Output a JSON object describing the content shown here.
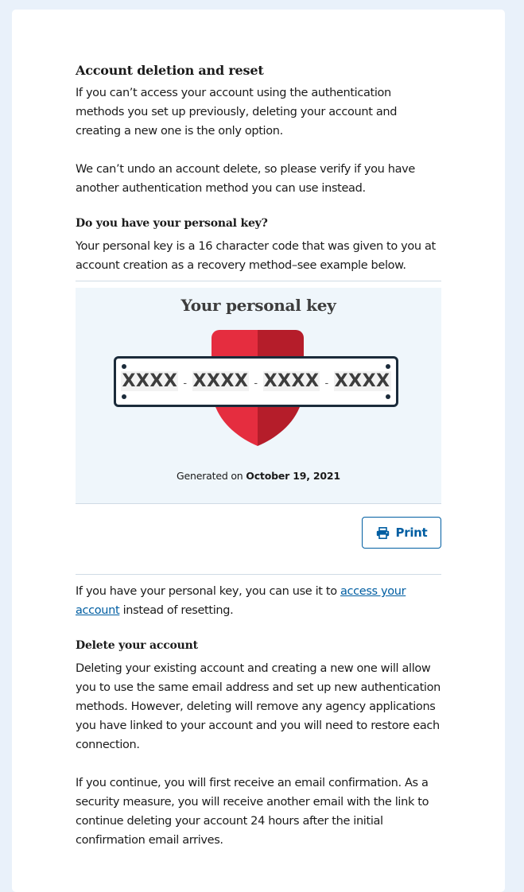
{
  "section": {
    "title": "Account deletion and reset",
    "intro": "If you can’t access your account using the authentication methods you set up previously, deleting your account and creating a new one is the only option.",
    "warning": "We can’t undo an account delete, so please verify if you have another authentication method you can use instead."
  },
  "personal_key": {
    "heading": "Do you have your personal key?",
    "description": "Your personal key is a 16 character code that was given to you at account creation as a recovery method–see example below.",
    "example_title": "Your personal key",
    "segments": [
      "XXXX",
      "XXXX",
      "XXXX",
      "XXXX"
    ],
    "separator": "-",
    "generated_prefix": "Generated on",
    "generated_date": "October 19, 2021",
    "print_label": "Print",
    "print_icon": "printer-icon",
    "access_prefix": "If you have your personal key, you can use it to",
    "access_link": "access your account",
    "access_suffix": "instead of resetting."
  },
  "delete": {
    "heading": "Delete your account",
    "paragraph1": "Deleting your existing account and creating a new one will allow you to use the same email address and set up new authentication methods. However, deleting will remove any agency applications you have linked to your account and you will need to restore each connection.",
    "paragraph2": "If you continue, you will first receive an email confirmation. As a security measure, you will receive another email with the link to continue deleting your account 24 hours after the initial confirmation email arrives."
  },
  "colors": {
    "page_bg": "#e9f1fa",
    "link": "#005ea2",
    "shield_light": "#e52d3f",
    "shield_dark": "#b51d2a",
    "plate_border": "#1b2b3a",
    "keybox_bg": "#eff6fb"
  }
}
